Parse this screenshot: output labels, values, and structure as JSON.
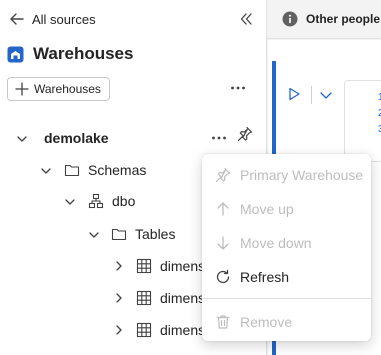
{
  "nav": {
    "back_label": "All sources"
  },
  "header": {
    "title": "Warehouses"
  },
  "toolbar": {
    "add_label": "Warehouses"
  },
  "tree": {
    "root": "demolake",
    "schemas": "Schemas",
    "schema": "dbo",
    "tables": "Tables",
    "items": [
      "dimens",
      "dimens",
      "dimens"
    ]
  },
  "right": {
    "notice": "Other people",
    "line_numbers": [
      "1",
      "2",
      "3"
    ]
  },
  "context_menu": {
    "items": [
      {
        "label": "Primary Warehouse",
        "enabled": false,
        "icon": "pin-icon"
      },
      {
        "label": "Move up",
        "enabled": false,
        "icon": "arrow-up-icon"
      },
      {
        "label": "Move down",
        "enabled": false,
        "icon": "arrow-down-icon"
      },
      {
        "label": "Refresh",
        "enabled": true,
        "icon": "refresh-icon"
      },
      {
        "label": "Remove",
        "enabled": false,
        "icon": "trash-icon"
      }
    ]
  },
  "colors": {
    "accent": "#2266c7",
    "disabled": "#bdbdbd",
    "info": "#616161"
  }
}
